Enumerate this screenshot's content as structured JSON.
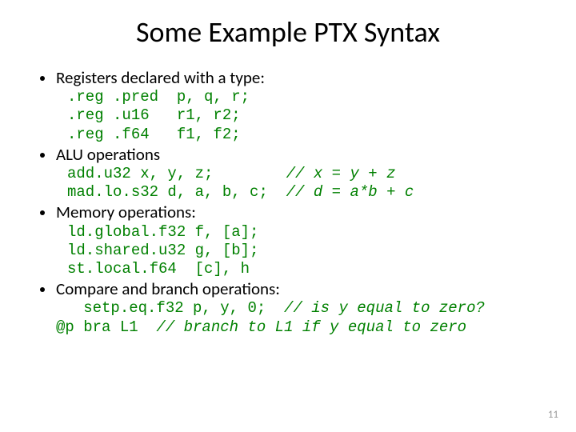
{
  "title": "Some Example PTX Syntax",
  "bullets": [
    {
      "text": "Registers declared with a type:"
    },
    {
      "text": "ALU operations"
    },
    {
      "text": "Memory operations:"
    },
    {
      "text": "Compare and branch operations:"
    }
  ],
  "code": {
    "registers": ".reg .pred  p, q, r;\n.reg .u16   r1, r2;\n.reg .f64   f1, f2;",
    "alu_line1": "add.u32 x, y, z;        ",
    "alu_comment1": "// x = y + z",
    "alu_line2": "mad.lo.s32 d, a, b, c;  ",
    "alu_comment2": "// d = a*b + c",
    "memory": "ld.global.f32 f, [a];\nld.shared.u32 g, [b];\nst.local.f64  [c], h",
    "cmp_line1": "   setp.eq.f32 p, y, 0;  ",
    "cmp_comment1": "// is y equal to zero?",
    "cmp_line2": "@p bra L1  ",
    "cmp_comment2": "// branch to L1 if y equal to zero"
  },
  "page_number": "11"
}
